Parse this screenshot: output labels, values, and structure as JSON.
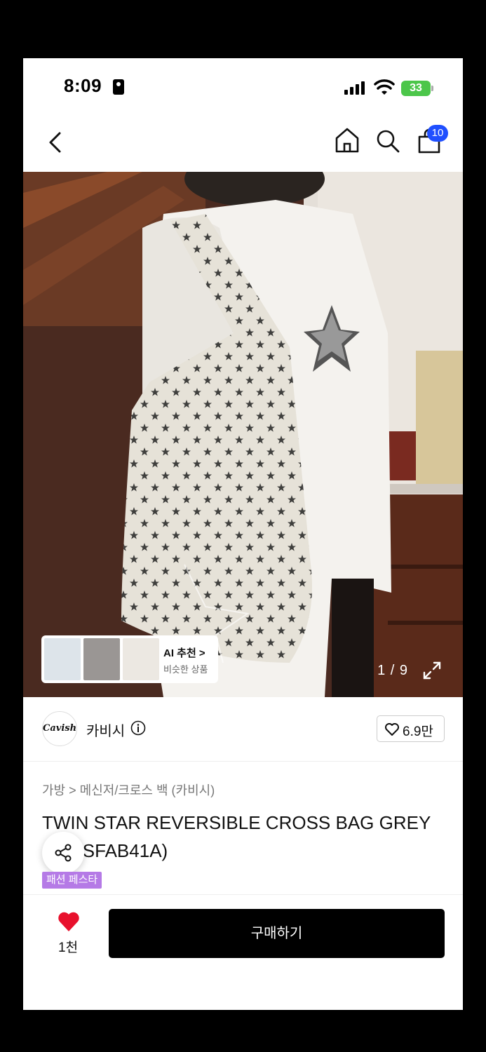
{
  "status_bar": {
    "time": "8:09",
    "battery": "33"
  },
  "nav": {
    "cart_count": "10"
  },
  "gallery": {
    "counter": "1 / 9"
  },
  "ai_recommend": {
    "title": "AI 추천 >",
    "subtitle": "비슷한 상품"
  },
  "brand": {
    "logo_text": "Cavish",
    "name": "카비시",
    "likes": "6.9만"
  },
  "breadcrumb": "가방 > 메신저/크로스 백 (카비시)",
  "product": {
    "title": "TWIN STAR REVERSIBLE CROSS BAG GREY (72GSFAB41A)",
    "tag": "패션 페스타"
  },
  "bottom": {
    "heart_count": "1천",
    "buy_label": "구매하기"
  },
  "colors": {
    "accent": "#1f4fff",
    "buy_button": "#000000",
    "heart": "#e8102c",
    "tag": "#b57ae6"
  }
}
